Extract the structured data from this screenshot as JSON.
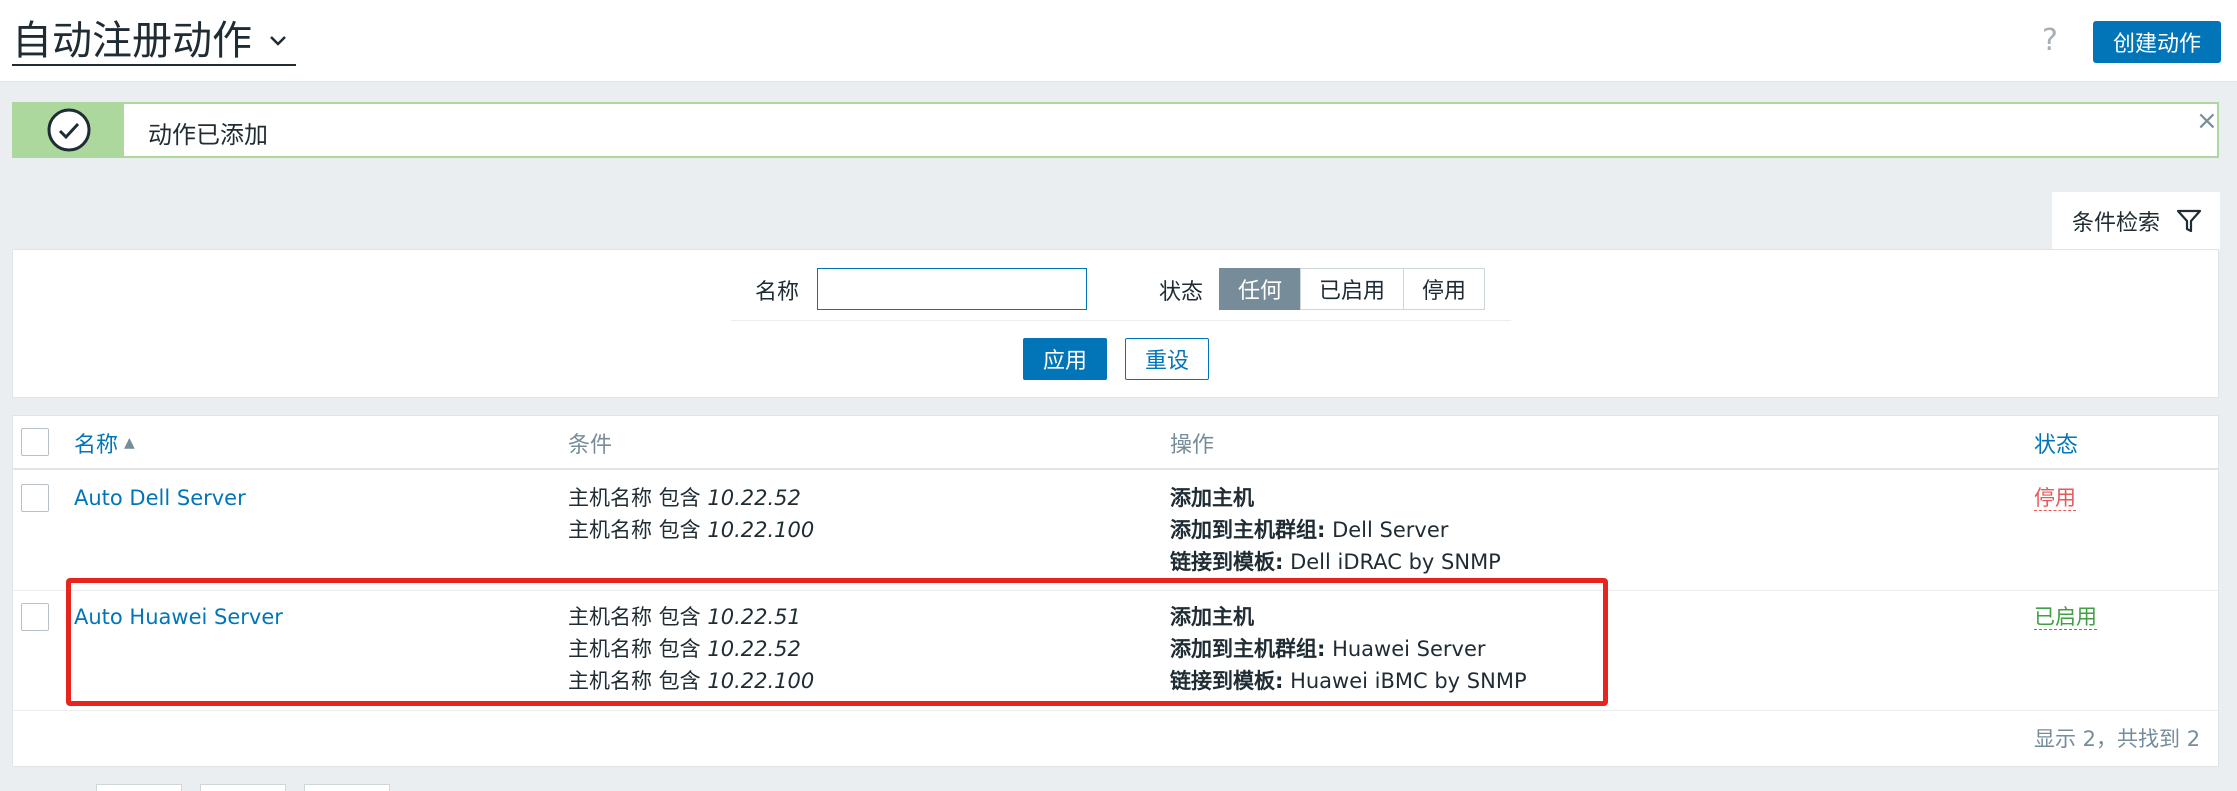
{
  "header": {
    "title": "自动注册动作",
    "help_label": "?",
    "create_label": "创建动作"
  },
  "message": {
    "text": "动作已添加",
    "close_label": "×"
  },
  "filter": {
    "tab_label": "条件检索",
    "name_label": "名称",
    "name_value": "",
    "status_label": "状态",
    "status_options": [
      "任何",
      "已启用",
      "停用"
    ],
    "status_selected": "任何",
    "apply_label": "应用",
    "reset_label": "重设"
  },
  "table": {
    "columns": {
      "name": "名称",
      "conditions": "条件",
      "operations": "操作",
      "status": "状态"
    },
    "sort_indicator": "▲",
    "rows": [
      {
        "name": "Auto Dell Server",
        "conditions": [
          {
            "prefix": "主机名称 包含 ",
            "value": "10.22.52"
          },
          {
            "prefix": "主机名称 包含 ",
            "value": "10.22.100"
          }
        ],
        "operations": [
          {
            "label": "添加主机",
            "value": ""
          },
          {
            "label": "添加到主机群组:",
            "value": " Dell Server"
          },
          {
            "label": "链接到模板:",
            "value": " Dell iDRAC by SNMP"
          }
        ],
        "status": "停用"
      },
      {
        "name": "Auto Huawei Server",
        "conditions": [
          {
            "prefix": "主机名称 包含 ",
            "value": "10.22.51"
          },
          {
            "prefix": "主机名称 包含 ",
            "value": "10.22.52"
          },
          {
            "prefix": "主机名称 包含 ",
            "value": "10.22.100"
          }
        ],
        "operations": [
          {
            "label": "添加主机",
            "value": ""
          },
          {
            "label": "添加到主机群组:",
            "value": " Huawei Server"
          },
          {
            "label": "链接到模板:",
            "value": " Huawei iBMC by SNMP"
          }
        ],
        "status": "已启用"
      }
    ],
    "footer": "显示 2，共找到 2"
  },
  "colors": {
    "accent": "#0275b8",
    "success": "#acd89d",
    "enabled": "#429e47",
    "disabled": "#e45959",
    "highlight": "#e8241f"
  }
}
